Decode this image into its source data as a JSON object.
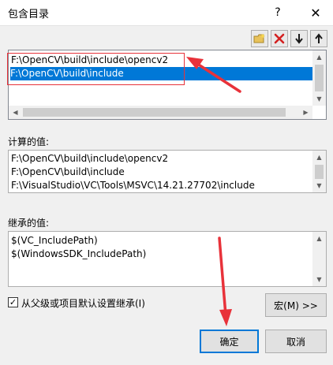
{
  "window": {
    "title": "包含目录",
    "help_label": "?",
    "close_label": "✕"
  },
  "toolbar": {
    "new_line_icon": "folder-new-icon",
    "delete_icon": "delete-x-icon",
    "move_down_icon": "arrow-down-icon",
    "move_up_icon": "arrow-up-icon"
  },
  "include_list": {
    "items": [
      {
        "text": "F:\\OpenCV\\build\\include\\opencv2",
        "selected": false
      },
      {
        "text": "F:\\OpenCV\\build\\include",
        "selected": true
      }
    ]
  },
  "evaluated": {
    "label": "计算的值:",
    "items": [
      "F:\\OpenCV\\build\\include\\opencv2",
      "F:\\OpenCV\\build\\include",
      "F:\\VisualStudio\\VC\\Tools\\MSVC\\14.21.27702\\include"
    ]
  },
  "inherited": {
    "label": "继承的值:",
    "items": [
      "$(VC_IncludePath)",
      "$(WindowsSDK_IncludePath)"
    ]
  },
  "inherit_checkbox": {
    "label": "从父级或项目默认设置继承(I)",
    "checked": true
  },
  "buttons": {
    "macro": "宏(M) >>",
    "ok": "确定",
    "cancel": "取消"
  },
  "colors": {
    "selection": "#0078d7",
    "annotation": "#e8323a"
  }
}
